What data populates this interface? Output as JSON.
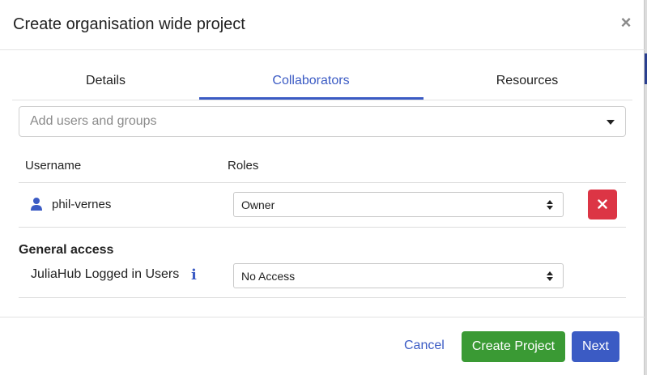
{
  "dialog": {
    "title": "Create organisation wide project",
    "close_glyph": "×"
  },
  "tabs": [
    {
      "label": "Details",
      "active": false
    },
    {
      "label": "Collaborators",
      "active": true
    },
    {
      "label": "Resources",
      "active": false
    }
  ],
  "add_users": {
    "placeholder": "Add users and groups",
    "icon": "chevron-down-icon"
  },
  "table": {
    "headers": {
      "username": "Username",
      "roles": "Roles"
    },
    "rows": [
      {
        "username": "phil-vernes",
        "role": "Owner",
        "icon": "user-icon",
        "action_icon": "close-icon"
      }
    ]
  },
  "general_access": {
    "title": "General access",
    "label": "JuliaHub Logged in Users",
    "value": "No Access",
    "info_icon": "info-icon"
  },
  "footer": {
    "cancel_label": "Cancel",
    "create_label": "Create Project",
    "next_label": "Next"
  },
  "colors": {
    "accent": "#3b5bc4",
    "create": "#3a9a34",
    "danger": "#dc3545"
  }
}
